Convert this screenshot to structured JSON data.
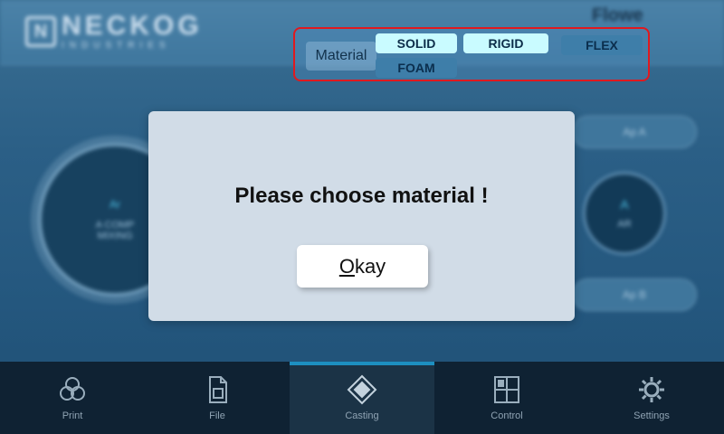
{
  "header": {
    "logo_main": "NECKOG",
    "logo_sub": "INDUSTRIES",
    "app_name": "Flowe"
  },
  "background": {
    "main_dial": {
      "badge": "Ar",
      "line1": "A COMP",
      "line2": "MIXING"
    },
    "side_dial": {
      "badge": "A",
      "label": "AR"
    },
    "pill_a": "Ap A",
    "pill_b": "Ap B"
  },
  "material": {
    "label": "Material",
    "options": [
      {
        "label": "SOLID",
        "state": "highlighted"
      },
      {
        "label": "RIGID",
        "state": "highlighted"
      },
      {
        "label": "FLEX",
        "state": "normal"
      },
      {
        "label": "FOAM",
        "state": "normal"
      }
    ]
  },
  "dialog": {
    "message": "Please choose material !",
    "button_mnemonic": "O",
    "button_rest": "kay"
  },
  "nav": {
    "items": [
      {
        "label": "Print",
        "icon": "print-icon",
        "active": false
      },
      {
        "label": "File",
        "icon": "file-icon",
        "active": false
      },
      {
        "label": "Casting",
        "icon": "casting-icon",
        "active": true
      },
      {
        "label": "Control",
        "icon": "control-icon",
        "active": false
      },
      {
        "label": "Settings",
        "icon": "gear-icon",
        "active": false
      }
    ]
  },
  "colors": {
    "highlight": "#c9fbff",
    "active_tab_bar": "#1d8fc0",
    "alert_border": "#e0191f"
  }
}
